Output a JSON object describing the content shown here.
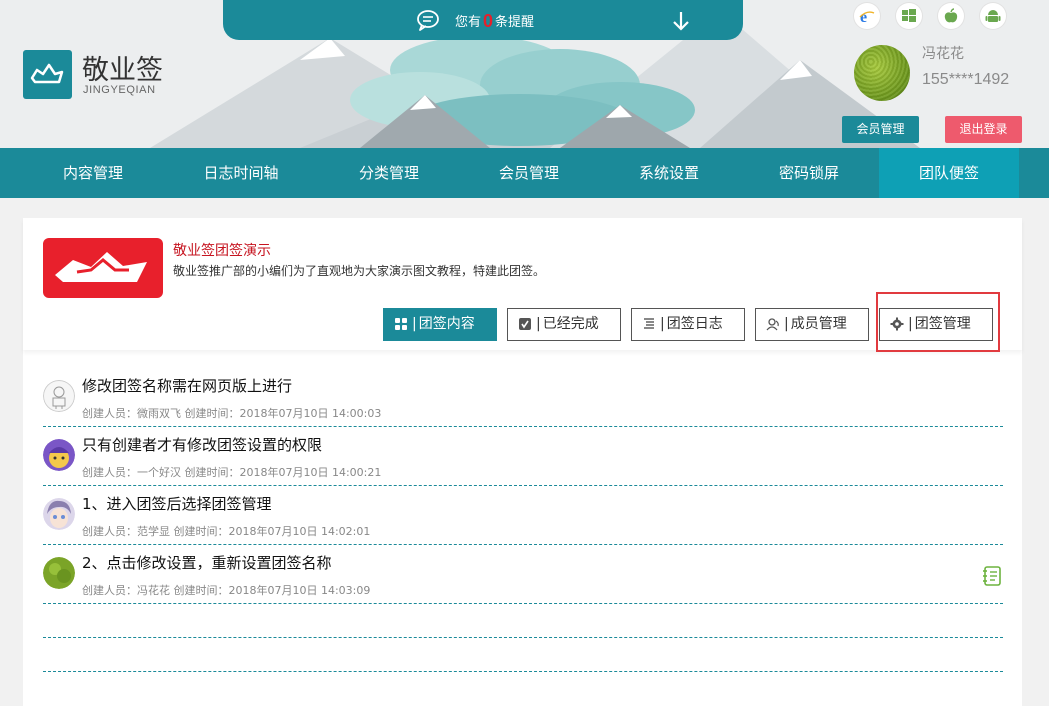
{
  "header": {
    "logo_title": "敬业签",
    "logo_sub": "JINGYEQIAN",
    "notice_prefix": "您有",
    "notice_count": "0",
    "notice_suffix": "条提醒",
    "platforms": [
      "ie-icon",
      "windows-icon",
      "apple-icon",
      "android-icon"
    ],
    "user_name": "冯花花",
    "user_phone": "155****1492",
    "member_button": "会员管理",
    "logout_button": "退出登录"
  },
  "nav": {
    "items": [
      "内容管理",
      "日志时间轴",
      "分类管理",
      "会员管理",
      "系统设置",
      "密码锁屏",
      "团队便签"
    ],
    "active_index": 6
  },
  "team": {
    "name": "敬业签团签演示",
    "description": "敬业签推广部的小编们为了直观地为大家演示图文教程，特建此团签。",
    "buttons": {
      "content": "团签内容",
      "done": "已经完成",
      "log": "团签日志",
      "members": "成员管理",
      "settings": "团签管理"
    },
    "separator": "|"
  },
  "notes": [
    {
      "title": "修改团签名称需在网页版上进行",
      "meta": "创建人员：微雨双飞 创建时间：2018年07月10日 14:00:03"
    },
    {
      "title": "只有创建者才有修改团签设置的权限",
      "meta": "创建人员：一个好汉 创建时间：2018年07月10日 14:00:21"
    },
    {
      "title": "1、进入团签后选择团签管理",
      "meta": "创建人员：范学显 创建时间：2018年07月10日 14:02:01"
    },
    {
      "title": "2、点击修改设置，重新设置团签名称",
      "meta": "创建人员：冯花花 创建时间：2018年07月10日 14:03:09"
    }
  ],
  "colors": {
    "primary": "#1b8a99",
    "nav_active": "#0ea0b5",
    "logout": "#ee5a6d",
    "team_logo": "#e8202c",
    "highlight": "#e13a3f"
  }
}
